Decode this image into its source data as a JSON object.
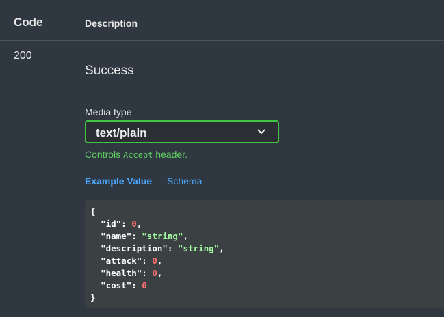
{
  "table": {
    "code_header": "Code",
    "description_header": "Description"
  },
  "response": {
    "code": "200",
    "description": "Success",
    "media_type_label": "Media type",
    "media_type_value": "text/plain",
    "controls_prefix": "Controls ",
    "controls_code": "Accept",
    "controls_suffix": " header."
  },
  "tabs": {
    "example_value": "Example Value",
    "schema": "Schema"
  },
  "example": {
    "open": "{",
    "close": "}",
    "fields": [
      {
        "key": "\"id\"",
        "value": "0",
        "type": "num",
        "comma": ","
      },
      {
        "key": "\"name\"",
        "value": "\"string\"",
        "type": "str",
        "comma": ","
      },
      {
        "key": "\"description\"",
        "value": "\"string\"",
        "type": "str",
        "comma": ","
      },
      {
        "key": "\"attack\"",
        "value": "0",
        "type": "num",
        "comma": ","
      },
      {
        "key": "\"health\"",
        "value": "0",
        "type": "num",
        "comma": ","
      },
      {
        "key": "\"cost\"",
        "value": "0",
        "type": "num",
        "comma": ""
      }
    ]
  },
  "colors": {
    "background": "#2f3841",
    "select_border": "#41c441",
    "link": "#4ea7ff",
    "string": "#a2fca2",
    "number": "#ff6f6f"
  }
}
